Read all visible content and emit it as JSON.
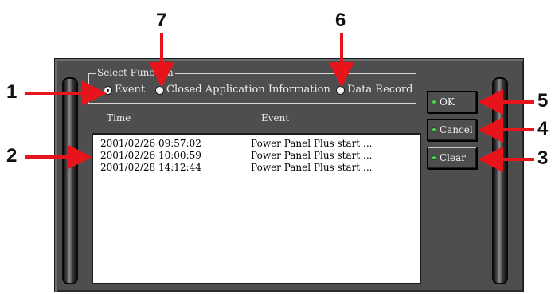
{
  "dialog": {
    "select_function": {
      "legend": "Select Function",
      "options": [
        {
          "label": "Event",
          "selected": true
        },
        {
          "label": "Closed Application Information",
          "selected": false
        },
        {
          "label": "Data Record",
          "selected": false
        }
      ]
    },
    "columns": {
      "time": "Time",
      "event": "Event"
    },
    "rows": [
      {
        "time": "2001/02/26 09:57:02",
        "event": "Power Panel Plus start ..."
      },
      {
        "time": "2001/02/26 10:00:59",
        "event": "Power Panel Plus start ..."
      },
      {
        "time": "2001/02/28 14:12:44",
        "event": "Power Panel Plus start ..."
      }
    ],
    "buttons": {
      "ok": "OK",
      "cancel": "Cancel",
      "clear": "Clear"
    }
  },
  "callouts": {
    "c1": "1",
    "c2": "2",
    "c3": "3",
    "c4": "4",
    "c5": "5",
    "c6": "6",
    "c7": "7"
  },
  "colors": {
    "panel": "#4e4e4e",
    "callout_arrow": "#e8141b",
    "button_led": "#4fd44f",
    "list_bg": "#ffffff"
  }
}
